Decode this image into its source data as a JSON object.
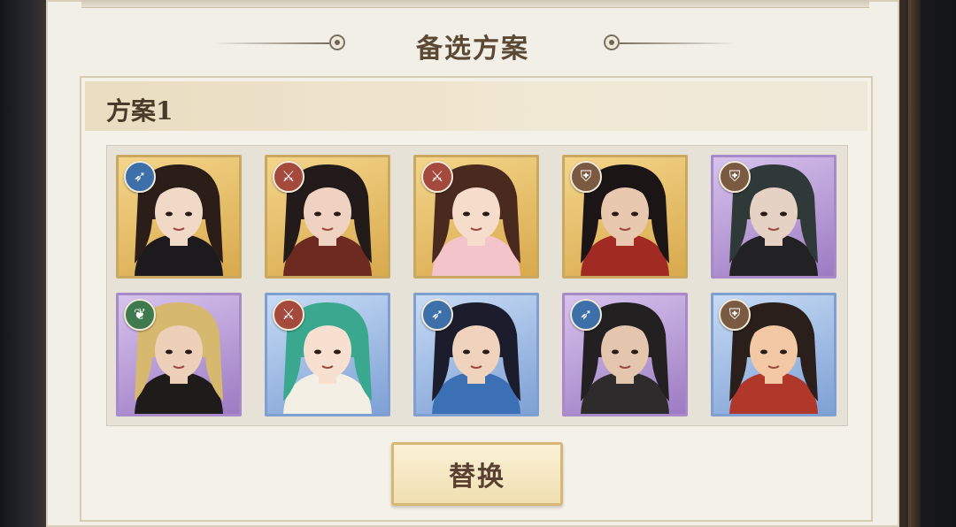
{
  "section": {
    "title": "备选方案"
  },
  "plan": {
    "title": "方案1",
    "replace_label": "替换",
    "heroes": [
      {
        "frame": "gold",
        "class_icon": "arrow-icon",
        "class_color": "#3d6fa8",
        "skin": "#f1d9c8",
        "hair": "#2b1d18",
        "outfit": "#1c1a1d"
      },
      {
        "frame": "gold",
        "class_icon": "sword-icon",
        "class_color": "#a34a3c",
        "skin": "#f0d2c2",
        "hair": "#231a1a",
        "outfit": "#6d2a20"
      },
      {
        "frame": "gold",
        "class_icon": "sword-icon",
        "class_color": "#a34a3c",
        "skin": "#f6dcca",
        "hair": "#4a2a1e",
        "outfit": "#f3c4c9"
      },
      {
        "frame": "gold",
        "class_icon": "shield-icon",
        "class_color": "#7a5a40",
        "skin": "#e9c8b0",
        "hair": "#1b1515",
        "outfit": "#a12a22"
      },
      {
        "frame": "purple",
        "class_icon": "shield-icon",
        "class_color": "#7a5a40",
        "skin": "#e6d2c4",
        "hair": "#2f3a38",
        "outfit": "#222224"
      },
      {
        "frame": "purple",
        "class_icon": "leaf-icon",
        "class_color": "#3f7a4e",
        "skin": "#ecd1b8",
        "hair": "#d6b96e",
        "outfit": "#1f1b1a"
      },
      {
        "frame": "blue",
        "class_icon": "sword-icon",
        "class_color": "#a34a3c",
        "skin": "#f7e0cf",
        "hair": "#3aa88e",
        "outfit": "#f4efe4"
      },
      {
        "frame": "blue",
        "class_icon": "arrow-icon",
        "class_color": "#3d6fa8",
        "skin": "#efd3bd",
        "hair": "#1b1d2c",
        "outfit": "#3b70b4"
      },
      {
        "frame": "purple",
        "class_icon": "arrow-icon",
        "class_color": "#3d6fa8",
        "skin": "#e3c6ad",
        "hair": "#232021",
        "outfit": "#2d2b2c"
      },
      {
        "frame": "blue",
        "class_icon": "shield-icon",
        "class_color": "#7a5a40",
        "skin": "#f2c9a4",
        "hair": "#2a1f1a",
        "outfit": "#b0382a"
      }
    ]
  }
}
